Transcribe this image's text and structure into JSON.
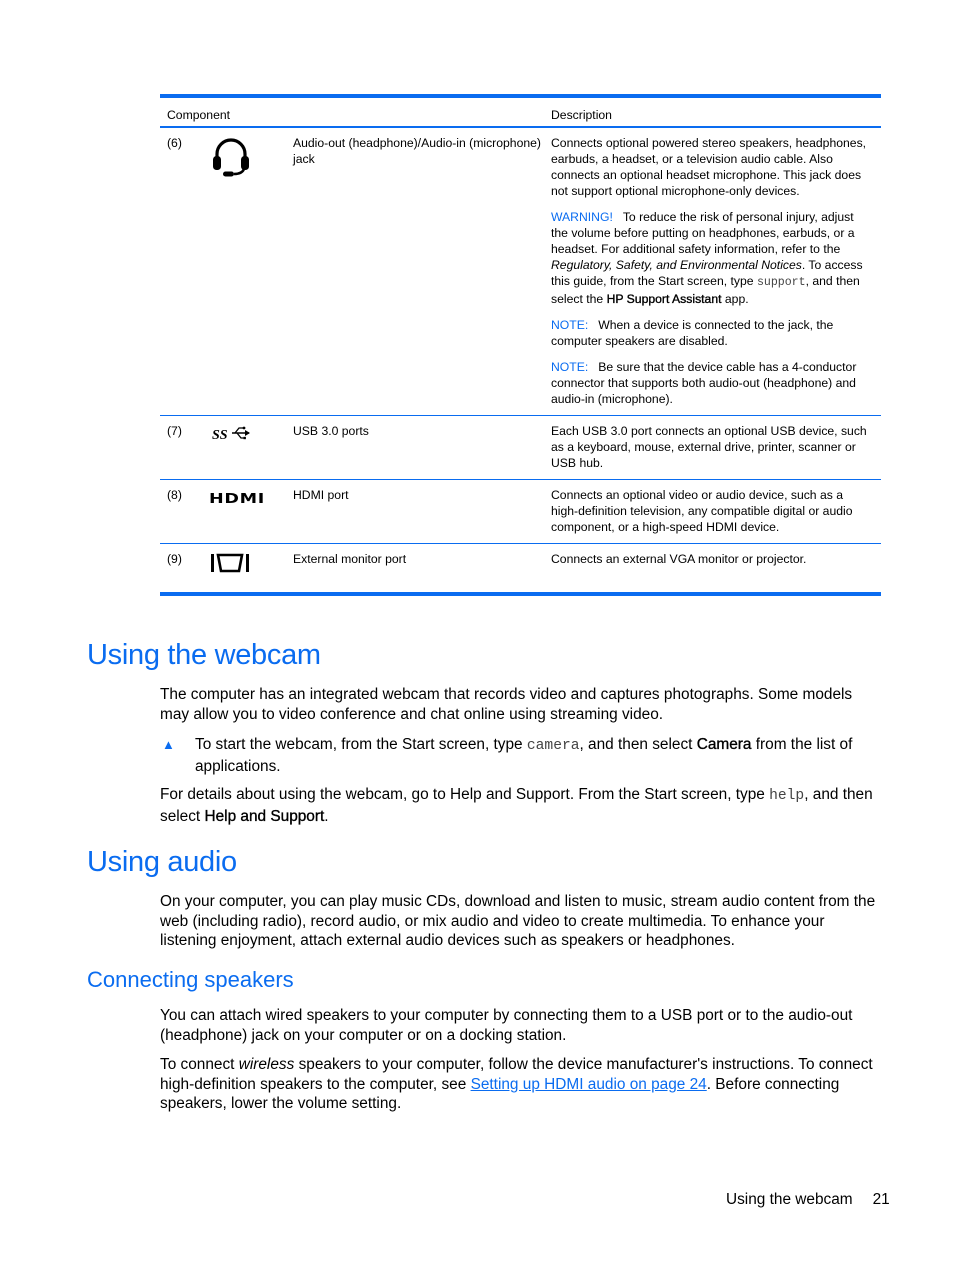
{
  "table": {
    "headers": {
      "component": "Component",
      "description": "Description"
    },
    "rows": [
      {
        "num": "(6)",
        "icon": "headset-icon",
        "name": "Audio-out (headphone)/Audio-in (microphone) jack",
        "desc_main": "Connects optional powered stereo speakers, headphones, earbuds, a headset, or a television audio cable. Also connects an optional headset microphone. This jack does not support optional microphone-only devices.",
        "warning": {
          "label": "WARNING!",
          "text1": "To reduce the risk of personal injury, adjust the volume before putting on headphones, earbuds, or a headset. For additional safety information, refer to the ",
          "italic": "Regulatory, Safety, and Environmental Notices",
          "text2": ". To access this guide, from the Start screen, type ",
          "code": "support",
          "text3": ", and then select the ",
          "bold": "HP Support Assistant",
          "text4": " app."
        },
        "note1": {
          "label": "NOTE:",
          "text": "When a device is connected to the jack, the computer speakers are disabled."
        },
        "note2": {
          "label": "NOTE:",
          "text": "Be sure that the device cable has a 4-conductor connector that supports both audio-out (headphone) and audio-in (microphone)."
        }
      },
      {
        "num": "(7)",
        "icon": "usb-superspeed-icon",
        "name": "USB 3.0 ports",
        "desc": "Each USB 3.0 port connects an optional USB device, such as a keyboard, mouse, external drive, printer, scanner or USB hub."
      },
      {
        "num": "(8)",
        "icon": "hdmi-icon",
        "icon_text": "HDMI",
        "name": "HDMI port",
        "desc": "Connects an optional video or audio device, such as a high-definition television, any compatible digital or audio component, or a high-speed HDMI device."
      },
      {
        "num": "(9)",
        "icon": "vga-monitor-icon",
        "name": "External monitor port",
        "desc": "Connects an external VGA monitor or projector."
      }
    ]
  },
  "webcam": {
    "heading": "Using the webcam",
    "para1": "The computer has an integrated webcam that records video and captures photographs. Some models may allow you to video conference and chat online using streaming video.",
    "bullet": {
      "text1": "To start the webcam, from the Start screen, type ",
      "code": "camera",
      "text2": ", and then select ",
      "bold": "Camera",
      "text3": " from the list of applications."
    },
    "para2": {
      "text1": "For details about using the webcam, go to Help and Support. From the Start screen, type ",
      "code": "help",
      "text2": ", and then select ",
      "bold": "Help and Support",
      "text3": "."
    }
  },
  "audio": {
    "heading": "Using audio",
    "para1": "On your computer, you can play music CDs, download and listen to music, stream audio content from the web (including radio), record audio, or mix audio and video to create multimedia. To enhance your listening enjoyment, attach external audio devices such as speakers or headphones.",
    "speakers": {
      "heading": "Connecting speakers",
      "para1": "You can attach wired speakers to your computer by connecting them to a USB port or to the audio-out (headphone) jack on your computer or on a docking station.",
      "para2": {
        "text1": "To connect ",
        "italic": "wireless",
        "text2": " speakers to your computer, follow the device manufacturer's instructions. To connect high-definition speakers to the computer, see ",
        "link": "Setting up HDMI audio on page 24",
        "text3": ". Before connecting speakers, lower the volume setting."
      }
    }
  },
  "footer": {
    "section": "Using the webcam",
    "page": "21"
  },
  "colors": {
    "accent": "#0a6cf0"
  }
}
